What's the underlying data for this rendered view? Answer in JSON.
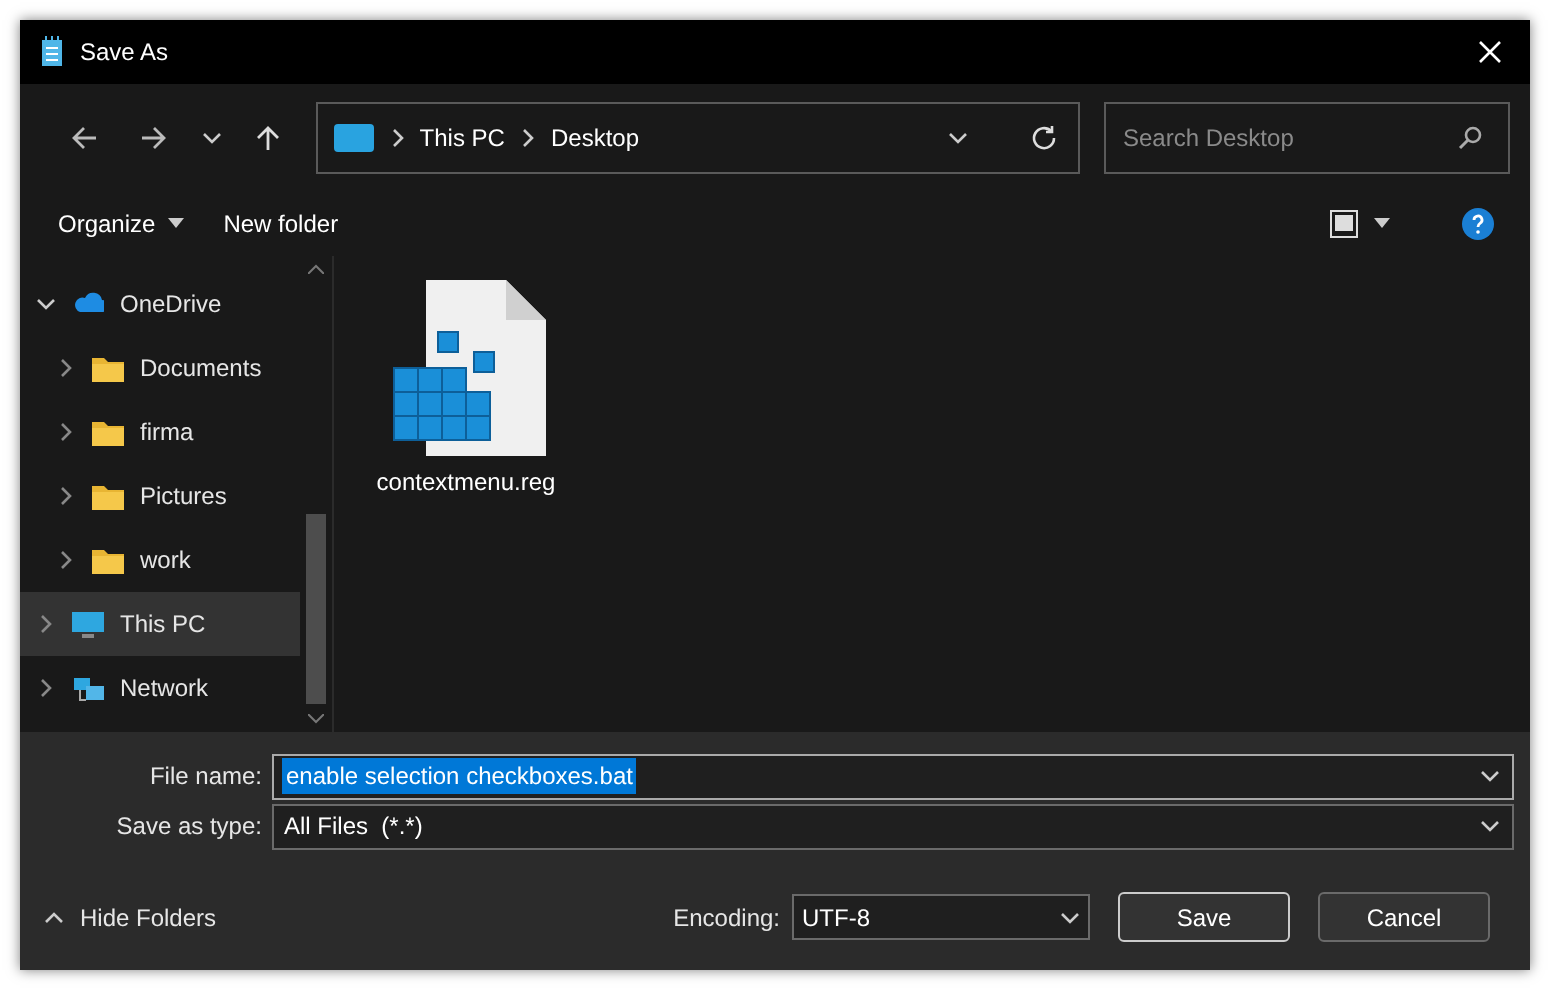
{
  "window": {
    "title": "Save As"
  },
  "address_bar": {
    "path": [
      "This PC",
      "Desktop"
    ]
  },
  "search": {
    "placeholder": "Search Desktop"
  },
  "toolbar": {
    "buttons": [
      {
        "label": "Organize",
        "kind": "menu"
      },
      {
        "label": "New folder",
        "kind": "plain"
      }
    ]
  },
  "sidebar": {
    "items": [
      {
        "label": "OneDrive",
        "kind": "cloud",
        "expanded": true,
        "selected": false,
        "children": [
          {
            "label": "Documents",
            "kind": "folder",
            "expanded": false,
            "selected": false
          },
          {
            "label": "firma",
            "kind": "folder",
            "expanded": false,
            "selected": false
          },
          {
            "label": "Pictures",
            "kind": "folder",
            "expanded": false,
            "selected": false
          },
          {
            "label": "work",
            "kind": "folder",
            "expanded": false,
            "selected": false
          }
        ]
      },
      {
        "label": "This PC",
        "kind": "pc",
        "expanded": false,
        "selected": true
      },
      {
        "label": "Network",
        "kind": "network",
        "expanded": false,
        "selected": false
      }
    ]
  },
  "files": [
    {
      "name": "contextmenu.reg"
    }
  ],
  "form": {
    "file_name": {
      "label": "File name:",
      "value": "enable selection checkboxes.bat"
    },
    "save_as_type": {
      "label": "Save as type:",
      "value": "All Files  (*.*)"
    }
  },
  "footer": {
    "hide_folders": "Hide Folders",
    "encoding": {
      "label": "Encoding:",
      "value": "UTF-8"
    },
    "buttons": [
      "Save",
      "Cancel"
    ]
  }
}
